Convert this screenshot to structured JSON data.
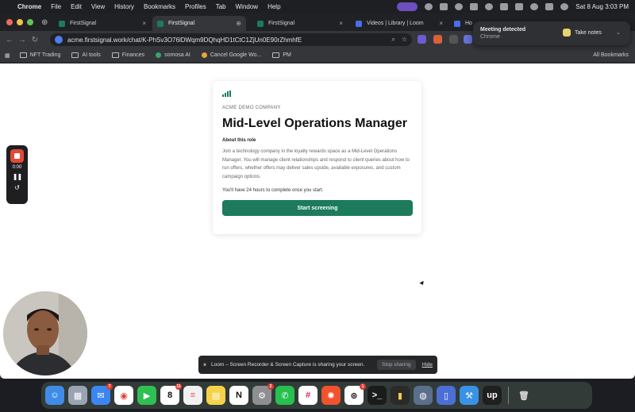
{
  "menubar": {
    "items": [
      "Chrome",
      "File",
      "Edit",
      "View",
      "History",
      "Bookmarks",
      "Profiles",
      "Tab",
      "Window",
      "Help"
    ],
    "datetime": "Sat 8 Aug  3:03 PM"
  },
  "tabs": [
    {
      "title": "FirstSignal"
    },
    {
      "title": "FirstSignal"
    },
    {
      "title": "FirstSignal"
    },
    {
      "title": "Videos | Library | Loom"
    },
    {
      "title": "Ho"
    }
  ],
  "address_bar": {
    "url": "acme.firstsignal.work/chat/K-PhSv3O76lDWqm9DQhqHD1tCtC1ZjUn0E90rZhmhfE"
  },
  "bookmarks": [
    {
      "label": "NFT Trading"
    },
    {
      "label": "AI tools"
    },
    {
      "label": "Finances"
    },
    {
      "label": "somosa AI"
    },
    {
      "label": "Cancel Google Wo..."
    },
    {
      "label": "PM"
    }
  ],
  "all_bookmarks_label": "All Bookmarks",
  "meeting_popup": {
    "title": "Meeting detected",
    "subtitle": "Chrome",
    "button": "Take notes"
  },
  "card": {
    "company": "ACME DEMO COMPANY",
    "role": "Mid-Level Operations Manager",
    "about_heading": "About this role",
    "description": "Join a technology company in the loyalty rewards space as a Mid-Level Operations Manager. You will manage client relationships and respond to client queries about how to run offers, whether offers may deliver sales upside, available exposures, and custom campaign options.",
    "time_note": "You'll have 24 hours to complete once you start.",
    "start_button": "Start screening"
  },
  "recorder": {
    "time": "0:00"
  },
  "sharebar": {
    "message": "Loom – Screen Recorder & Screen Capture is sharing your screen.",
    "stop": "Stop sharing",
    "hide": "Hide"
  },
  "dock": {
    "calendar_day": "8",
    "badges": {
      "mail": "7",
      "calendar": "11",
      "settings": "2",
      "chatgpt": "1"
    }
  },
  "colors": {
    "accent_green": "#1c7a5d",
    "record_red": "#e14a36"
  }
}
